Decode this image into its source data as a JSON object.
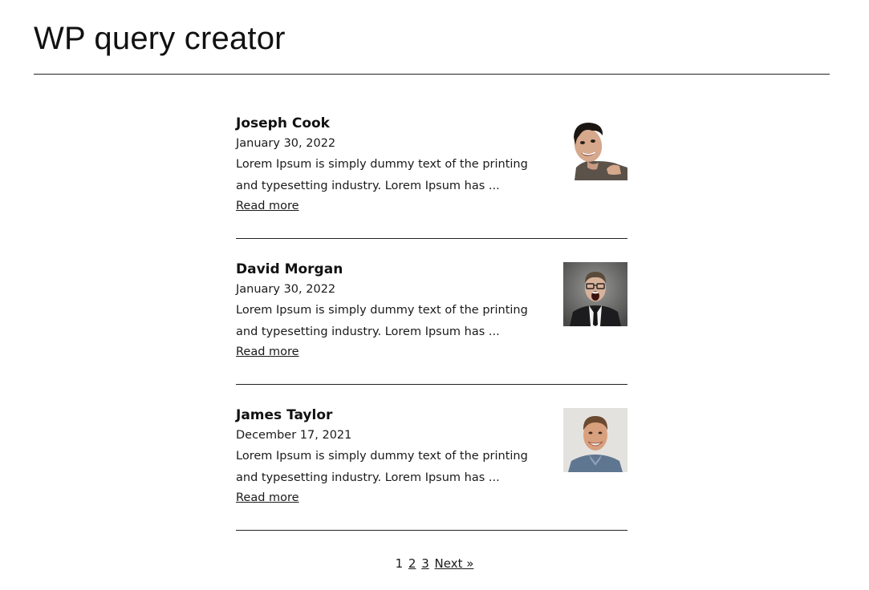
{
  "page": {
    "title": "WP query creator"
  },
  "posts": [
    {
      "title": "Joseph Cook",
      "date": "January 30, 2022",
      "excerpt_line1": "Lorem Ipsum is simply dummy text of the printing",
      "excerpt_line2": "and typesetting industry. Lorem Ipsum has ...",
      "read_more": "Read more",
      "avatar_icon": "man-laughing-photo"
    },
    {
      "title": "David Morgan",
      "date": "January 30, 2022",
      "excerpt_line1": "Lorem Ipsum is simply dummy text of the printing",
      "excerpt_line2": "and typesetting industry. Lorem Ipsum has ...",
      "read_more": "Read more",
      "avatar_icon": "man-in-suit-screaming-photo"
    },
    {
      "title": "James Taylor",
      "date": "December 17, 2021",
      "excerpt_line1": "Lorem Ipsum is simply dummy text of the printing",
      "excerpt_line2": "and typesetting industry. Lorem Ipsum has ...",
      "read_more": "Read more",
      "avatar_icon": "man-smiling-photo"
    }
  ],
  "pagination": {
    "current": "1",
    "pages": [
      "2",
      "3"
    ],
    "next_label": "Next »"
  }
}
